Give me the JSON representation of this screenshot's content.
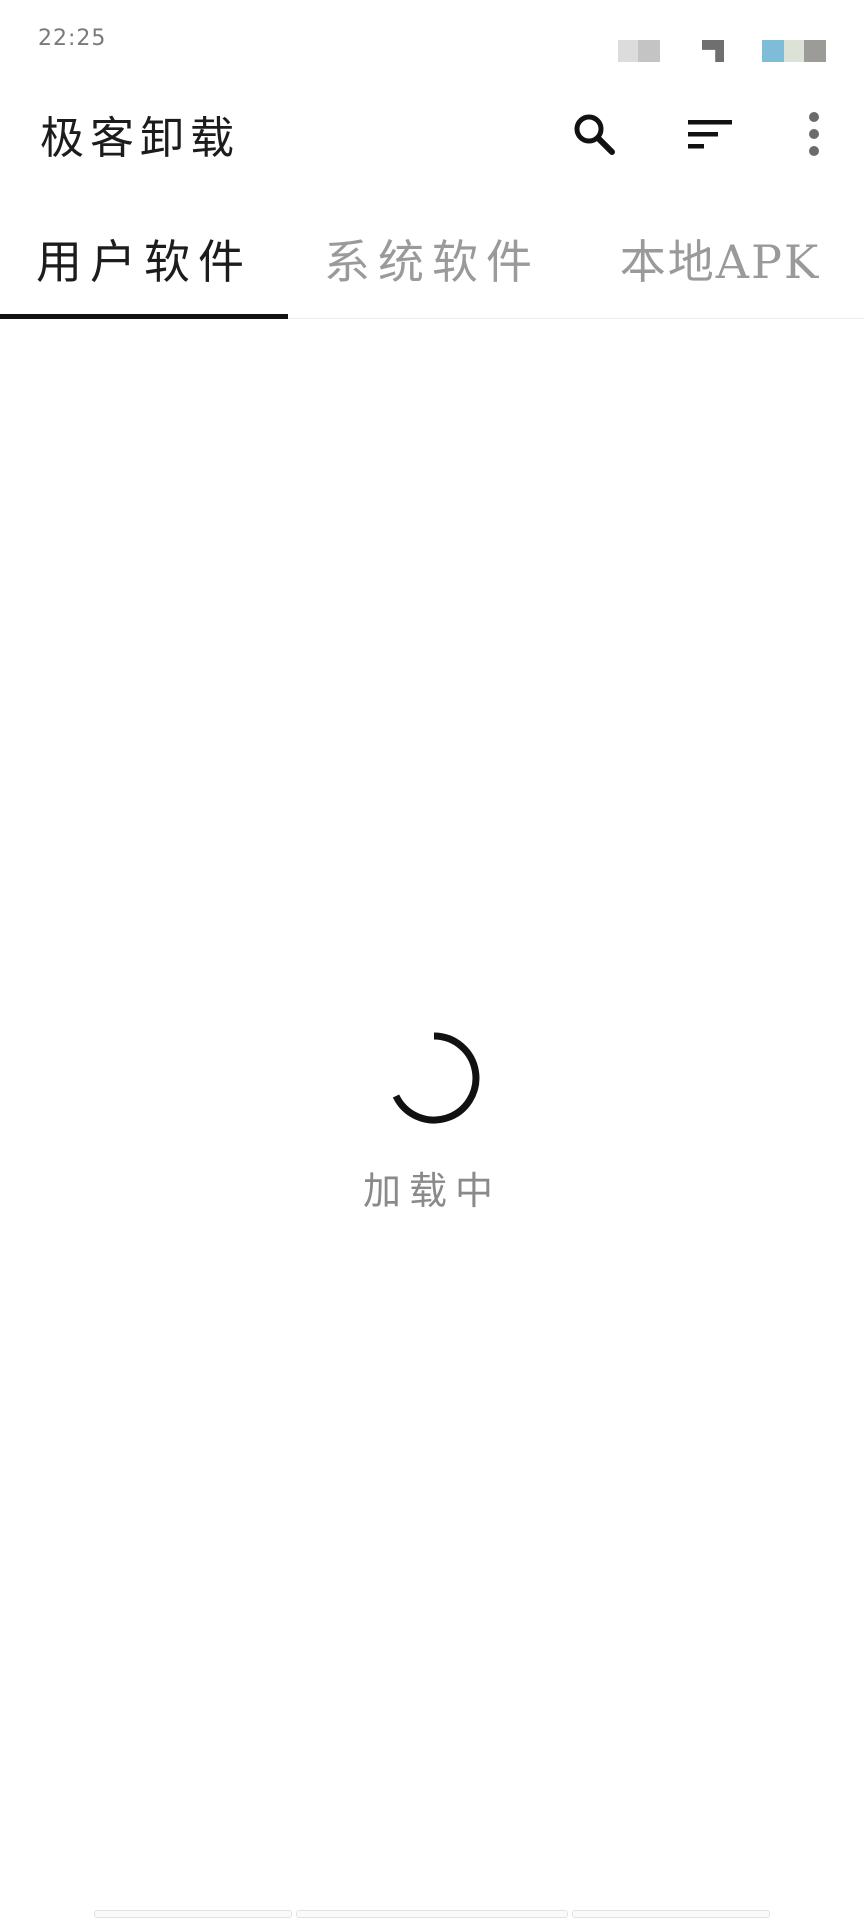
{
  "status_bar": {
    "time": "22:25",
    "colors": {
      "block_light": "#dcdcdc",
      "block_mid": "#c4c4c4",
      "block_dark": "#6f6f6f",
      "block_blue": "#7fbcd8",
      "block_pale": "#dde2d6",
      "block_gray": "#9b9b98"
    }
  },
  "app_bar": {
    "title": "极客卸载",
    "icons": [
      "search-icon",
      "sort-icon",
      "more-vert-icon"
    ]
  },
  "tabs": {
    "items": [
      {
        "label": "用户软件",
        "active": true
      },
      {
        "label": "系统软件",
        "active": false
      },
      {
        "label": "本地APK",
        "active": false
      }
    ]
  },
  "loading": {
    "label": "加载中"
  },
  "theme": {
    "text_primary": "#1c1c1c",
    "text_secondary": "#9a9a9a",
    "indicator": "#111111"
  }
}
